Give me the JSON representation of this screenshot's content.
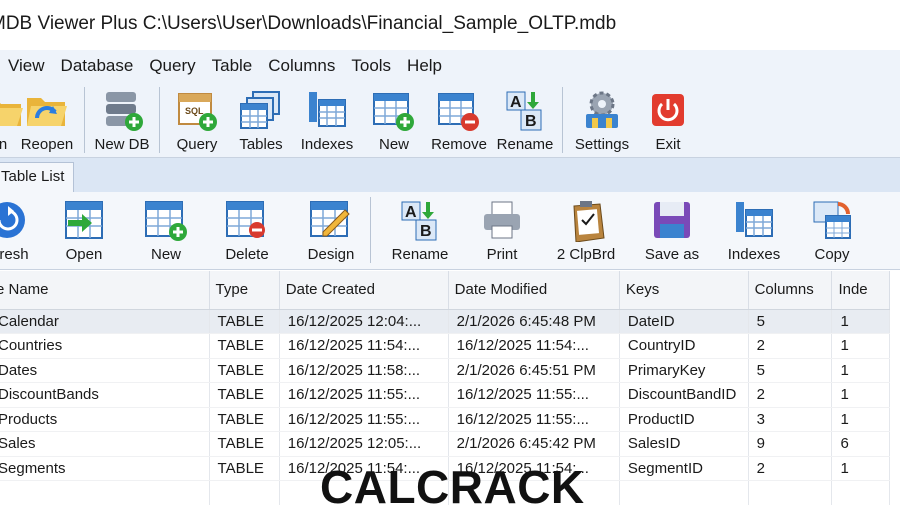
{
  "window": {
    "title": "MDB Viewer Plus C:\\Users\\User\\Downloads\\Financial_Sample_OLTP.mdb"
  },
  "menu": [
    "View",
    "Database",
    "Query",
    "Table",
    "Columns",
    "Tools",
    "Help"
  ],
  "main_toolbar": {
    "open_partial": "n",
    "reopen": "Reopen",
    "new_db": "New DB",
    "query": "Query",
    "tables": "Tables",
    "indexes": "Indexes",
    "new": "New",
    "remove": "Remove",
    "rename": "Rename",
    "settings": "Settings",
    "exit": "Exit",
    "query_icon_text": "SQL"
  },
  "tab": {
    "label": "Table List"
  },
  "table_toolbar": {
    "refresh": "resh",
    "open": "Open",
    "new": "New",
    "delete": "Delete",
    "design": "Design",
    "rename": "Rename",
    "print": "Print",
    "clipboard": "2 ClpBrd",
    "save_as": "Save as",
    "indexes": "Indexes",
    "copy": "Copy"
  },
  "grid": {
    "columns": [
      "e Name",
      "Type",
      "Date Created",
      "Date Modified",
      "Keys",
      "Columns",
      "Inde"
    ],
    "rows": [
      [
        "Calendar",
        "TABLE",
        "16/12/2025 12:04:...",
        "2/1/2026 6:45:48 PM",
        "DateID",
        "5",
        "1"
      ],
      [
        "Countries",
        "TABLE",
        "16/12/2025 11:54:...",
        "16/12/2025 11:54:...",
        "CountryID",
        "2",
        "1"
      ],
      [
        "Dates",
        "TABLE",
        "16/12/2025 11:58:...",
        "2/1/2026 6:45:51 PM",
        "PrimaryKey",
        "5",
        "1"
      ],
      [
        "DiscountBands",
        "TABLE",
        "16/12/2025 11:55:...",
        "16/12/2025 11:55:...",
        "DiscountBandID",
        "2",
        "1"
      ],
      [
        "Products",
        "TABLE",
        "16/12/2025 11:55:...",
        "16/12/2025 11:55:...",
        "ProductID",
        "3",
        "1"
      ],
      [
        "Sales",
        "TABLE",
        "16/12/2025 12:05:...",
        "2/1/2026 6:45:42 PM",
        "SalesID",
        "9",
        "6"
      ],
      [
        "Segments",
        "TABLE",
        "16/12/2025 11:54:...",
        "16/12/2025 11:54:...",
        "SegmentID",
        "2",
        "1"
      ]
    ],
    "selected_row": 0
  },
  "watermark": "CALCRACK"
}
